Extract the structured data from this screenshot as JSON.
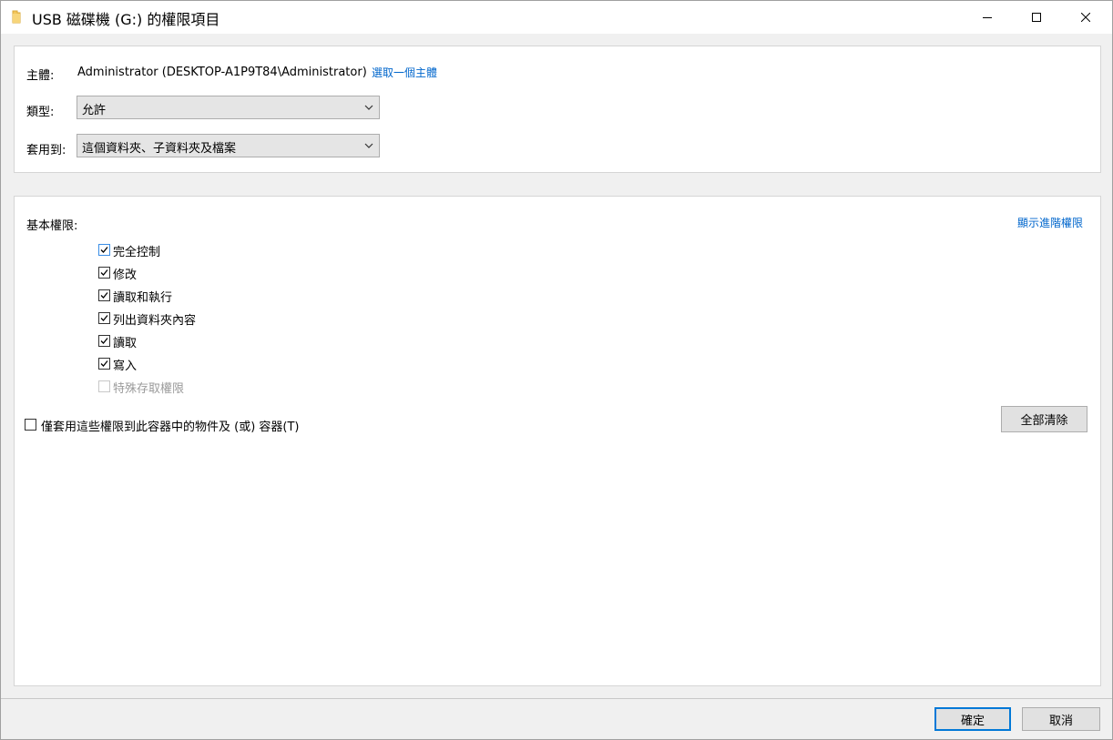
{
  "window": {
    "title": "USB 磁碟機 (G:) 的權限項目",
    "controls": {
      "minimize": "minimize",
      "maximize": "maximize",
      "close": "close"
    }
  },
  "principal": {
    "label": "主體:",
    "value": "Administrator (DESKTOP-A1P9T84\\Administrator)",
    "select_link": "選取一個主體"
  },
  "type": {
    "label": "類型:",
    "value": "允許"
  },
  "applies_to": {
    "label": "套用到:",
    "value": "這個資料夾、子資料夾及檔案"
  },
  "basic_permissions": {
    "label": "基本權限:",
    "advanced_link": "顯示進階權限",
    "items": [
      {
        "label": "完全控制",
        "checked": true,
        "enabled": true
      },
      {
        "label": "修改",
        "checked": true,
        "enabled": true
      },
      {
        "label": "讀取和執行",
        "checked": true,
        "enabled": true
      },
      {
        "label": "列出資料夾內容",
        "checked": true,
        "enabled": true
      },
      {
        "label": "讀取",
        "checked": true,
        "enabled": true
      },
      {
        "label": "寫入",
        "checked": true,
        "enabled": true
      },
      {
        "label": "特殊存取權限",
        "checked": false,
        "enabled": false
      }
    ]
  },
  "apply_only_container": {
    "label": "僅套用這些權限到此容器中的物件及 (或) 容器(T)",
    "checked": false
  },
  "clear_all_button": "全部清除",
  "ok_button": "確定",
  "cancel_button": "取消",
  "colors": {
    "link": "#0066cc",
    "default_button_border": "#0078d7",
    "folder_icon": "#f2c55c"
  }
}
